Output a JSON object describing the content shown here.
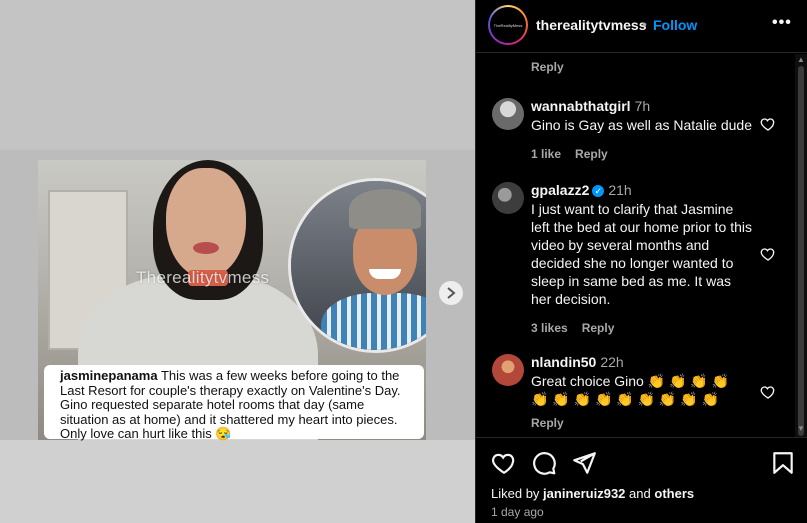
{
  "post": {
    "watermark": "Therealitytvmess",
    "caption_user": "jasminepanama",
    "caption_text": "This was a few weeks before going to the Last Resort for couple's therapy exactly on Valentine's Day. Gino requested separate hotel rooms that day (same situation as at home) and it shattered my heart into pieces. Only love can hurt like this 😪",
    "next_icon": "chevron-right-icon"
  },
  "header": {
    "username": "therealitytvmess",
    "separator": "•",
    "follow_label": "Follow",
    "more_label": "•••",
    "avatar_text": "TheRealityMess"
  },
  "comments": {
    "top_reply_label": "Reply",
    "items": [
      {
        "username": "wannabthatgirl",
        "time": "7h",
        "text": "Gino is Gay as well as Natalie dude",
        "likes": "1 like",
        "reply": "Reply"
      },
      {
        "username": "gpalazz2",
        "verified": true,
        "time": "21h",
        "text": "I just want to clarify that Jasmine left the bed at our home prior to this video by several months and decided she no longer wanted to sleep in same bed as me. It was her decision.",
        "likes": "3 likes",
        "reply": "Reply"
      },
      {
        "username": "nlandin50",
        "time": "22h",
        "text": "Great choice Gino 👏 👏 👏 👏 👏 👏 👏 👏 👏 👏 👏 👏 👏",
        "reply": "Reply"
      }
    ]
  },
  "footer": {
    "liked_prefix": "Liked by",
    "liked_user": "janineruiz932",
    "liked_and": "and",
    "liked_others": "others",
    "date": "1 day ago"
  },
  "colors": {
    "background": "#000000",
    "accent": "#0095f6",
    "muted": "#a8a8a8"
  }
}
